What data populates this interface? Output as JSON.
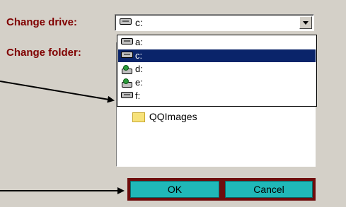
{
  "labels": {
    "change_drive": "Change drive:",
    "change_folder": "Change folder:"
  },
  "drive_combo": {
    "value": "c:",
    "icon": "hard-drive-icon"
  },
  "drive_list": [
    {
      "label": "a:",
      "icon": "hard-drive-icon",
      "selected": false
    },
    {
      "label": "c:",
      "icon": "hard-drive-icon",
      "selected": true
    },
    {
      "label": "d:",
      "icon": "network-drive-icon",
      "selected": false
    },
    {
      "label": "e:",
      "icon": "network-drive-icon",
      "selected": false
    },
    {
      "label": "f:",
      "icon": "hard-drive-icon",
      "selected": false
    }
  ],
  "folders": [
    {
      "label": "QQImages",
      "icon": "folder-icon"
    }
  ],
  "buttons": {
    "ok": "OK",
    "cancel": "Cancel"
  },
  "colors": {
    "label": "#800000",
    "selection": "#0a246a",
    "button_face": "#20b8b8",
    "button_border": "#6e0d0d",
    "background": "#d4d0c8"
  }
}
